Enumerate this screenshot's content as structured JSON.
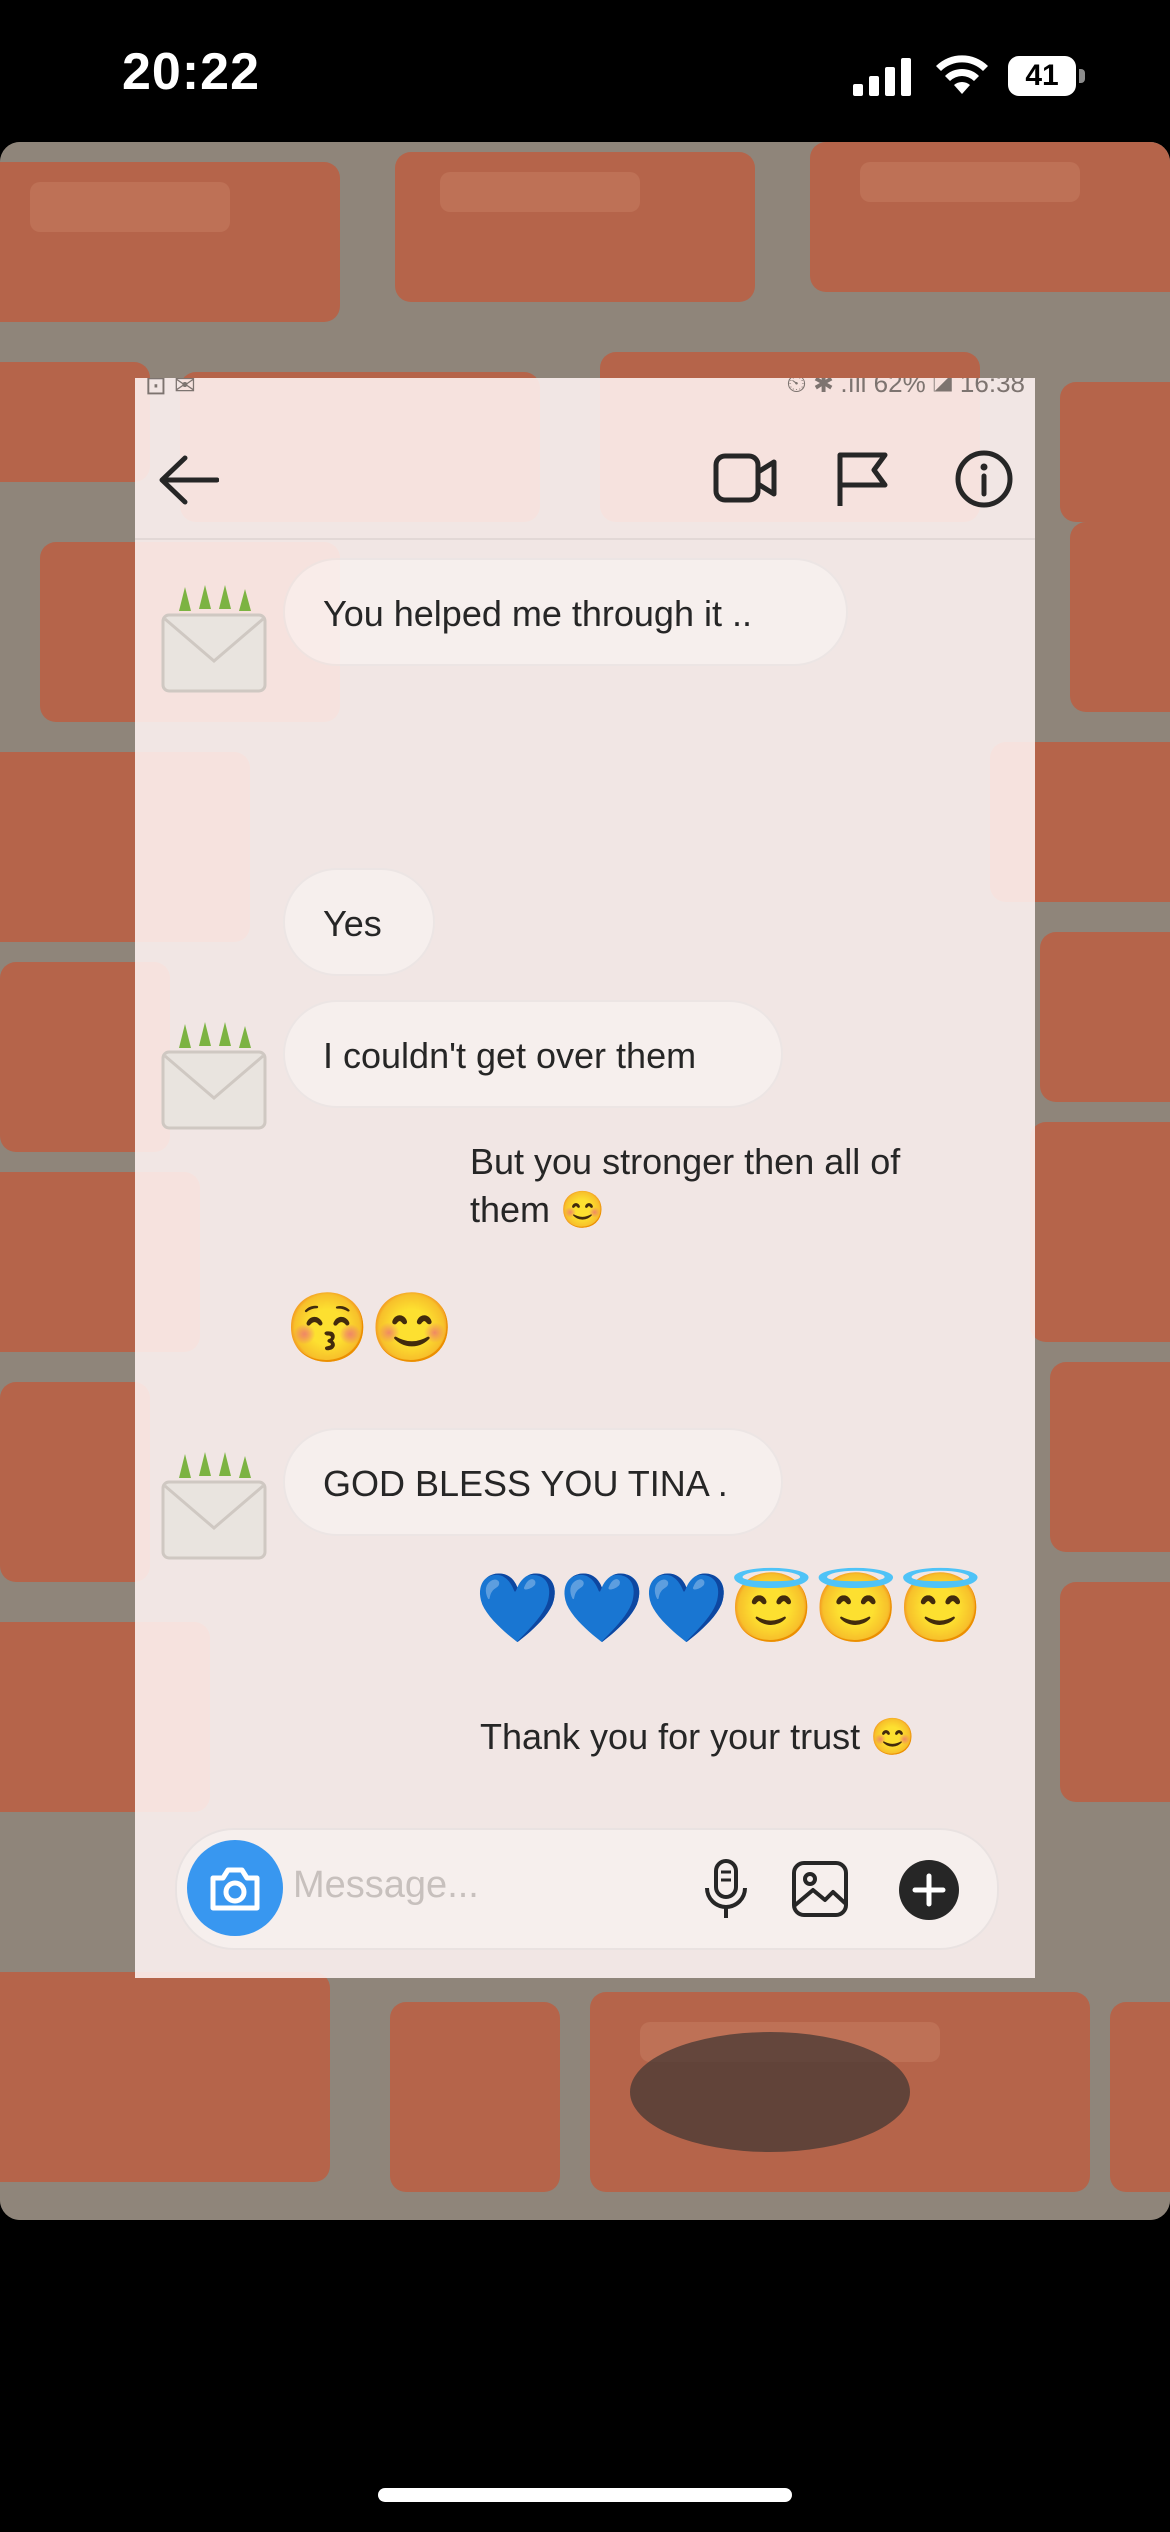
{
  "status_bar": {
    "time": "20:22",
    "battery": "41"
  },
  "overlay_status": {
    "left_icons": "⊡ ✉",
    "right_text": "⏲ ✱ .ıll 62% ◪ 16:38"
  },
  "messages": [
    {
      "text": "You helped me through it .."
    },
    {
      "text": "Yes"
    },
    {
      "text": "I couldn't get over them"
    },
    {
      "text": "But you stronger then all of them 😊"
    },
    {
      "text": "😚😊"
    },
    {
      "text": "GOD BLESS YOU TINA ."
    },
    {
      "text": "💙💙💙😇😇😇"
    },
    {
      "text": "Thank you for your trust 😊"
    }
  ],
  "composer": {
    "placeholder": "Message..."
  },
  "icons": {
    "back": "arrow-left-icon",
    "video": "video-call-icon",
    "flag": "flag-icon",
    "info": "info-icon",
    "camera": "camera-icon",
    "mic": "microphone-icon",
    "gallery": "image-gallery-icon",
    "plus": "plus-icon",
    "avatar": "envelope-avatar-icon"
  },
  "colors": {
    "accent": "#3897f0",
    "brick": "#b5644a",
    "mortar": "#8d8274"
  }
}
